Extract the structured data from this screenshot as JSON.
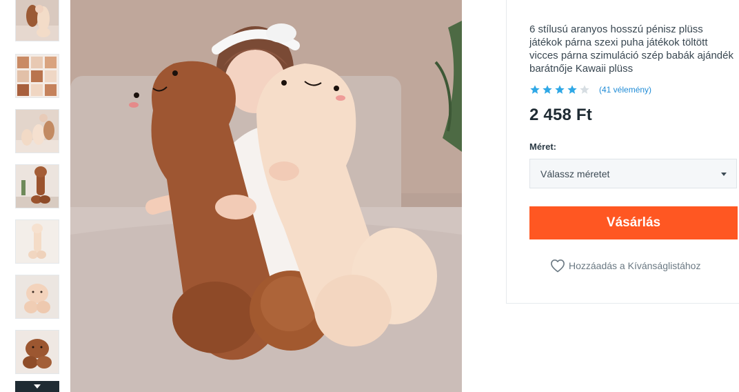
{
  "product": {
    "title": "6 stílusú aranyos hosszú pénisz plüss játékok párna szexi puha játékok töltött vicces párna szimuláció szép babák ajándék barátnője Kawaii plüss",
    "rating": 4,
    "rating_max": 5,
    "review_count_label": "(41 vélemény)",
    "price": "2 458 Ft"
  },
  "size_selector": {
    "label": "Méret:",
    "selected": "Válassz méretet"
  },
  "actions": {
    "buy_label": "Vásárlás",
    "wishlist_label": "Hozzáadás a Kívánságlistához"
  },
  "gallery": {
    "thumbnail_count": 7,
    "selected_index": 0,
    "scroll_down_icon": "chevron-down-icon"
  },
  "colors": {
    "accent": "#ff5722",
    "star": "#2fa8e6",
    "star_empty": "#d6dde2",
    "link": "#1f8bd6",
    "price": "#1f2b33"
  }
}
